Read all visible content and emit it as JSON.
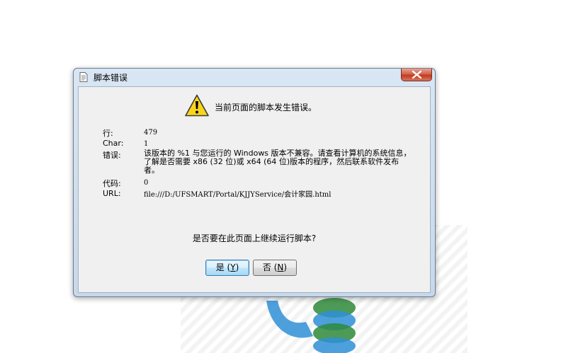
{
  "dialog": {
    "title": "脚本错误",
    "headline": "当前页面的脚本发生错误。",
    "fields": {
      "line_label": "行:",
      "line_value": "479",
      "char_label": "Char:",
      "char_value": "1",
      "error_label": "错误:",
      "error_value": "该版本的 %1 与您运行的 Windows 版本不兼容。请查看计算机的系统信息，了解是否需要 x86 (32 位)或 x64 (64 位)版本的程序，然后联系软件发布者。",
      "code_label": "代码:",
      "code_value": "0",
      "url_label": "URL:",
      "url_value": "file:///D:/UFSMART/Portal/KJJYService/会计家园.html"
    },
    "question": "是否要在此页面上继续运行脚本?",
    "yes_label": "是",
    "yes_hotkey": "Y",
    "no_label": "否",
    "no_hotkey": "N"
  },
  "icons": {
    "title": "document-icon",
    "close": "close-icon",
    "warning": "warning-icon"
  },
  "colors": {
    "close_button": "#c23a22",
    "warning_fill": "#f7d51d",
    "client_bg": "#f0f0f0"
  }
}
